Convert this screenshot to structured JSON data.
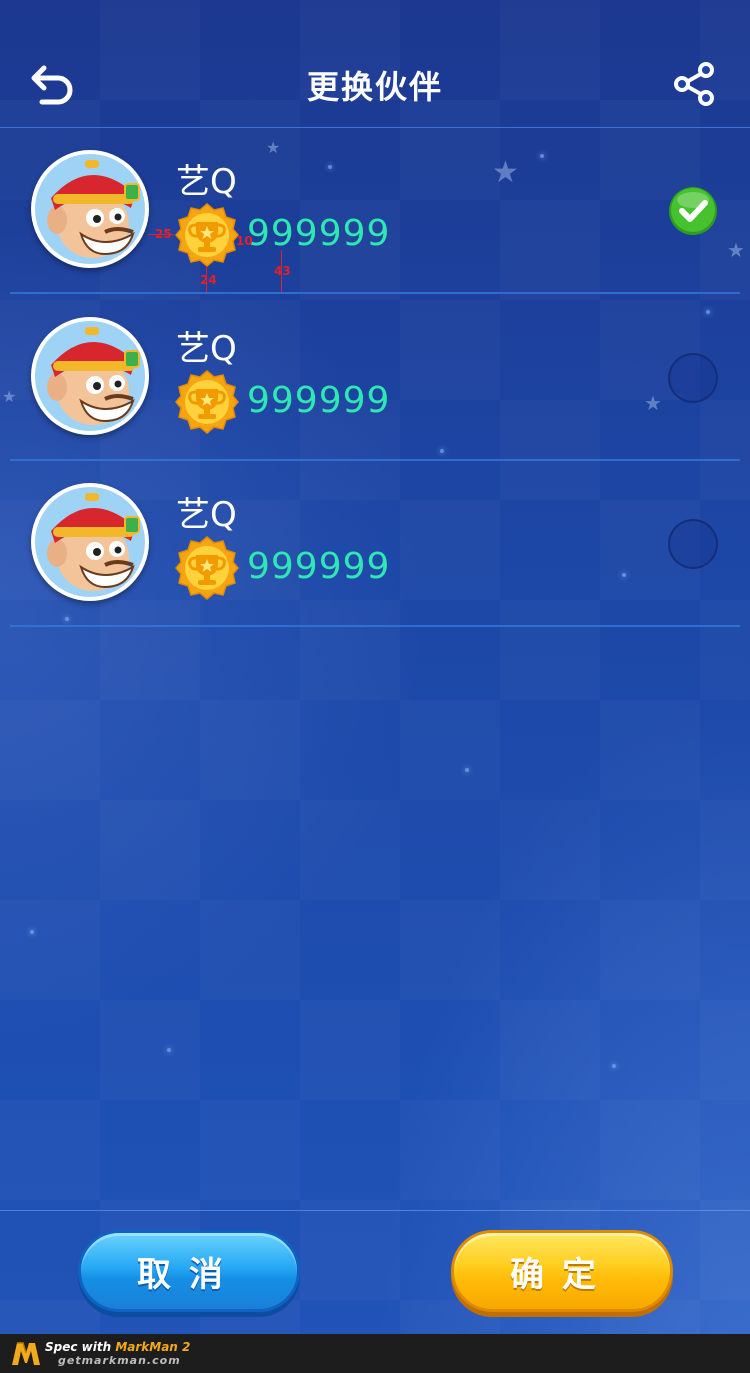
{
  "header": {
    "title": "更换伙伴",
    "back_icon": "undo-arrow-icon",
    "share_icon": "share-icon"
  },
  "partners": [
    {
      "name": "艺Q",
      "score": "999999",
      "selected": true
    },
    {
      "name": "艺Q",
      "score": "999999",
      "selected": false
    },
    {
      "name": "艺Q",
      "score": "999999",
      "selected": false
    }
  ],
  "spec_marks": {
    "gap_left": "25",
    "gap_right": "10",
    "icon_size": "24",
    "row_bottom": "43"
  },
  "footer": {
    "cancel_label": "取消",
    "confirm_label": "确定"
  },
  "watermark": {
    "line1_prefix": "Spec with ",
    "line1_brand": "MarkMan 2",
    "line2": "getmarkman.com"
  },
  "colors": {
    "accent_score": "#2ee8b3",
    "cancel_blue": "#28a8f4",
    "confirm_yellow": "#ffcc1c",
    "selected_green": "#3fbf2a"
  }
}
